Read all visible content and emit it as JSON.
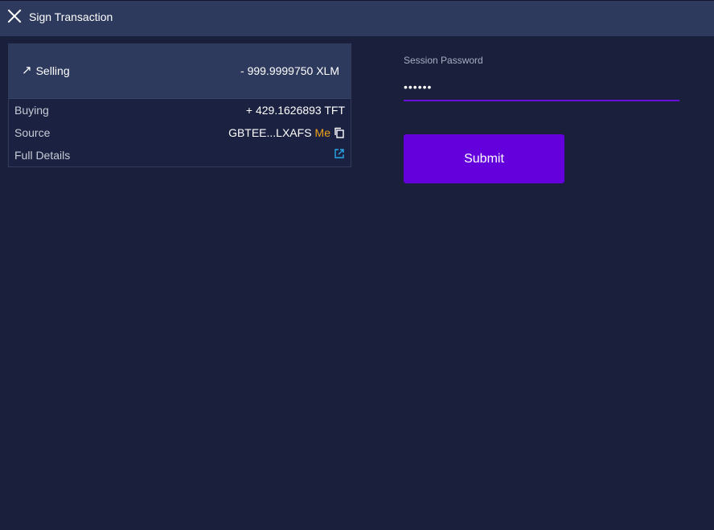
{
  "header": {
    "title": "Sign Transaction"
  },
  "transaction": {
    "selling": {
      "label": "Selling",
      "amount": "- 999.9999750 XLM"
    },
    "buying": {
      "label": "Buying",
      "amount": "+ 429.1626893 TFT"
    },
    "source": {
      "label": "Source",
      "address": "GBTEE...LXAFS",
      "tag": "Me"
    },
    "full_details": {
      "label": "Full Details"
    }
  },
  "form": {
    "password_label": "Session Password",
    "password_value": "••••••",
    "submit_label": "Submit"
  },
  "colors": {
    "background": "#1a1f3b",
    "header": "#2e3a5d",
    "accent": "#6400dc",
    "me_tag": "#f0a21a",
    "link": "#2aa6e8"
  },
  "icons": {
    "close": "close-icon",
    "selling": "arrow-up-right-icon",
    "copy": "copy-icon",
    "external": "external-link-icon"
  }
}
